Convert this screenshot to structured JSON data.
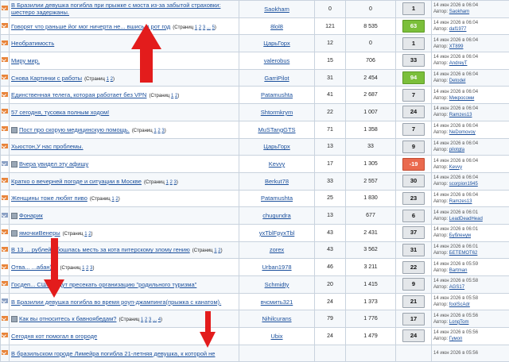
{
  "colors": {
    "icon_default": "#e8843a",
    "icon_alt": "#8aa0c4",
    "rating_green": "#7bbf3a",
    "rating_red": "#ea6a4e",
    "link": "#1a4f9c",
    "arrow": "#e31c1c"
  },
  "icon_name": "envelope-icon",
  "last_prefix": "Автор:",
  "rows": [
    {
      "title": "В Бразилии девушка погибла при прыжке с моста из-за забытой страховки: шестеро задержаны.",
      "pages": [],
      "author": "Saokham",
      "replies": "0",
      "views": "0",
      "rating": "1",
      "rating_style": "plain",
      "last_date": "14 июн 2026 в 06:04",
      "last_author": "Saokham",
      "icon": "orange",
      "poll": false
    },
    {
      "title": "Говорят что раньше йог мог ничерта не... вшись в рот год",
      "pages": [
        "1",
        "2",
        "3",
        "...",
        "5"
      ],
      "author": "8lol8",
      "replies": "121",
      "views": "8 535",
      "rating": "63",
      "rating_style": "green",
      "last_date": "14 июн 2026 в 06:04",
      "last_author": "daf1977",
      "icon": "orange",
      "poll": false
    },
    {
      "title": "Необратимость",
      "pages": [],
      "author": "ЦарьГорх",
      "replies": "12",
      "views": "0",
      "rating": "1",
      "rating_style": "plain",
      "last_date": "14 июн 2026 в 06:04",
      "last_author": "XT899",
      "icon": "orange",
      "poll": false
    },
    {
      "title": "Миру мир.",
      "pages": [],
      "author": "valerobus",
      "replies": "15",
      "views": "706",
      "rating": "33",
      "rating_style": "plain",
      "last_date": "14 июн 2026 в 06:04",
      "last_author": "AndreyT",
      "icon": "orange",
      "poll": false
    },
    {
      "title": "Снова Картинки с работы",
      "pages": [
        "1",
        "2"
      ],
      "author": "GarriPilot",
      "replies": "31",
      "views": "2 454",
      "rating": "94",
      "rating_style": "green",
      "last_date": "14 июн 2026 в 06:04",
      "last_author": "Detodel",
      "icon": "orange",
      "poll": false
    },
    {
      "title": "Единственная телега, которая работает без VPN",
      "pages": [
        "1",
        "2"
      ],
      "author": "Patamushta",
      "replies": "41",
      "views": "2 687",
      "rating": "7",
      "rating_style": "plain",
      "last_date": "14 июн 2026 в 06:04",
      "last_author": "Микросоми",
      "icon": "orange",
      "poll": false
    },
    {
      "title": "57 сегодня, тусовка полным ходом!",
      "pages": [],
      "author": "Shtormkrym",
      "replies": "22",
      "views": "1 007",
      "rating": "24",
      "rating_style": "plain",
      "last_date": "14 июн 2026 в 06:04",
      "last_author": "Ramzes13",
      "icon": "orange",
      "poll": false
    },
    {
      "title": "Пост про скорую медицинскую помощь.",
      "pages": [
        "1",
        "2",
        "3"
      ],
      "author": "MuSTangGTS",
      "replies": "71",
      "views": "1 358",
      "rating": "7",
      "rating_style": "plain",
      "last_date": "14 июн 2026 в 06:04",
      "last_author": "NeDomovoy",
      "icon": "orange",
      "poll": true
    },
    {
      "title": "Хьюстон,У нас проблемы.",
      "pages": [],
      "author": "ЦарьГорх",
      "replies": "13",
      "views": "33",
      "rating": "9",
      "rating_style": "plain",
      "last_date": "14 июн 2026 в 06:04",
      "last_author": "pilotgta",
      "icon": "orange",
      "poll": false
    },
    {
      "title": "Вчера увидел эту афишу",
      "pages": [],
      "author": "Kevvy",
      "replies": "17",
      "views": "1 305",
      "rating": "-19",
      "rating_style": "red",
      "last_date": "14 июн 2026 в 06:04",
      "last_author": "Kevvy",
      "icon": "alt",
      "poll": true
    },
    {
      "title": "Кратко о вечерней погоде и ситуации в Москве",
      "pages": [
        "1",
        "2",
        "3"
      ],
      "author": "Berkut78",
      "replies": "33",
      "views": "2 557",
      "rating": "30",
      "rating_style": "plain",
      "last_date": "14 июн 2026 в 06:04",
      "last_author": "scorpion1945",
      "icon": "orange",
      "poll": false
    },
    {
      "title": "Женщины тоже любят пиво",
      "pages": [
        "1",
        "2"
      ],
      "author": "Patamushta",
      "replies": "25",
      "views": "1 830",
      "rating": "23",
      "rating_style": "plain",
      "last_date": "14 июн 2026 в 06:04",
      "last_author": "Ramzes13",
      "icon": "orange",
      "poll": false
    },
    {
      "title": "Фонарик",
      "pages": [],
      "author": "chugundra",
      "replies": "13",
      "views": "677",
      "rating": "6",
      "rating_style": "plain",
      "last_date": "14 июн 2026 в 06:01",
      "last_author": "LeadDeadHead",
      "icon": "alt",
      "poll": true
    },
    {
      "title": "ямочкиВенеры",
      "pages": [
        "1",
        "2"
      ],
      "author": "yxTblFpyxTbl",
      "replies": "43",
      "views": "2 431",
      "rating": "37",
      "rating_style": "plain",
      "last_date": "14 июн 2026 в 06:01",
      "last_author": "Бубленум",
      "icon": "orange",
      "poll": true
    },
    {
      "title": "В 13 ... рублей обошлась месть за кота питерскому злому гению",
      "pages": [
        "1",
        "2"
      ],
      "author": "zorex",
      "replies": "43",
      "views": "3 562",
      "rating": "31",
      "rating_style": "plain",
      "last_date": "14 июн 2026 в 06:01",
      "last_author": "БЕТЕМОТ62",
      "icon": "orange",
      "poll": false
    },
    {
      "title": "Отва... ...абан))))",
      "pages": [
        "1",
        "2",
        "3"
      ],
      "author": "Urban1978",
      "replies": "46",
      "views": "3 211",
      "rating": "22",
      "rating_style": "plain",
      "last_date": "14 июн 2026 в 05:59",
      "last_author": "Bartman",
      "icon": "orange",
      "poll": false
    },
    {
      "title": "Госдеп... США будут пресекать организацию \"родильного туризма\"",
      "pages": [],
      "author": "Schmidty",
      "replies": "20",
      "views": "1 415",
      "rating": "9",
      "rating_style": "plain",
      "last_date": "14 июн 2026 в 05:58",
      "last_author": "AGS17",
      "icon": "orange",
      "poll": false
    },
    {
      "title": "В Бразилии девушка погибла во время роуп-джампинга(прыжка с канатом).",
      "pages": [],
      "author": "вчсмить321",
      "replies": "24",
      "views": "1 373",
      "rating": "21",
      "rating_style": "plain",
      "last_date": "14 июн 2026 в 05:58",
      "last_author": "foolScAdr",
      "icon": "alt",
      "poll": false
    },
    {
      "title": "Как вы относитесь к бавноябедам?",
      "pages": [
        "1",
        "2",
        "3",
        "...",
        "4"
      ],
      "author": "Nihilcurans",
      "replies": "79",
      "views": "1 776",
      "rating": "17",
      "rating_style": "plain",
      "last_date": "14 июн 2026 в 05:56",
      "last_author": "LongTom",
      "icon": "orange",
      "poll": true
    },
    {
      "title": "Сегодня кот помогал в огороде",
      "pages": [],
      "author": "Ubix",
      "replies": "24",
      "views": "1 479",
      "rating": "24",
      "rating_style": "plain",
      "last_date": "14 июн 2026 в 05:56",
      "last_author": "Гумоп",
      "icon": "orange",
      "poll": false
    },
    {
      "title": "В бразильском городе Лимейра погибла 21-летняя девушка, к которой не",
      "pages": [],
      "author": "",
      "replies": "",
      "views": "",
      "rating": "",
      "rating_style": "plain",
      "last_date": "14 июн 2026 в 05:56",
      "last_author": "",
      "icon": "orange",
      "poll": false
    }
  ]
}
